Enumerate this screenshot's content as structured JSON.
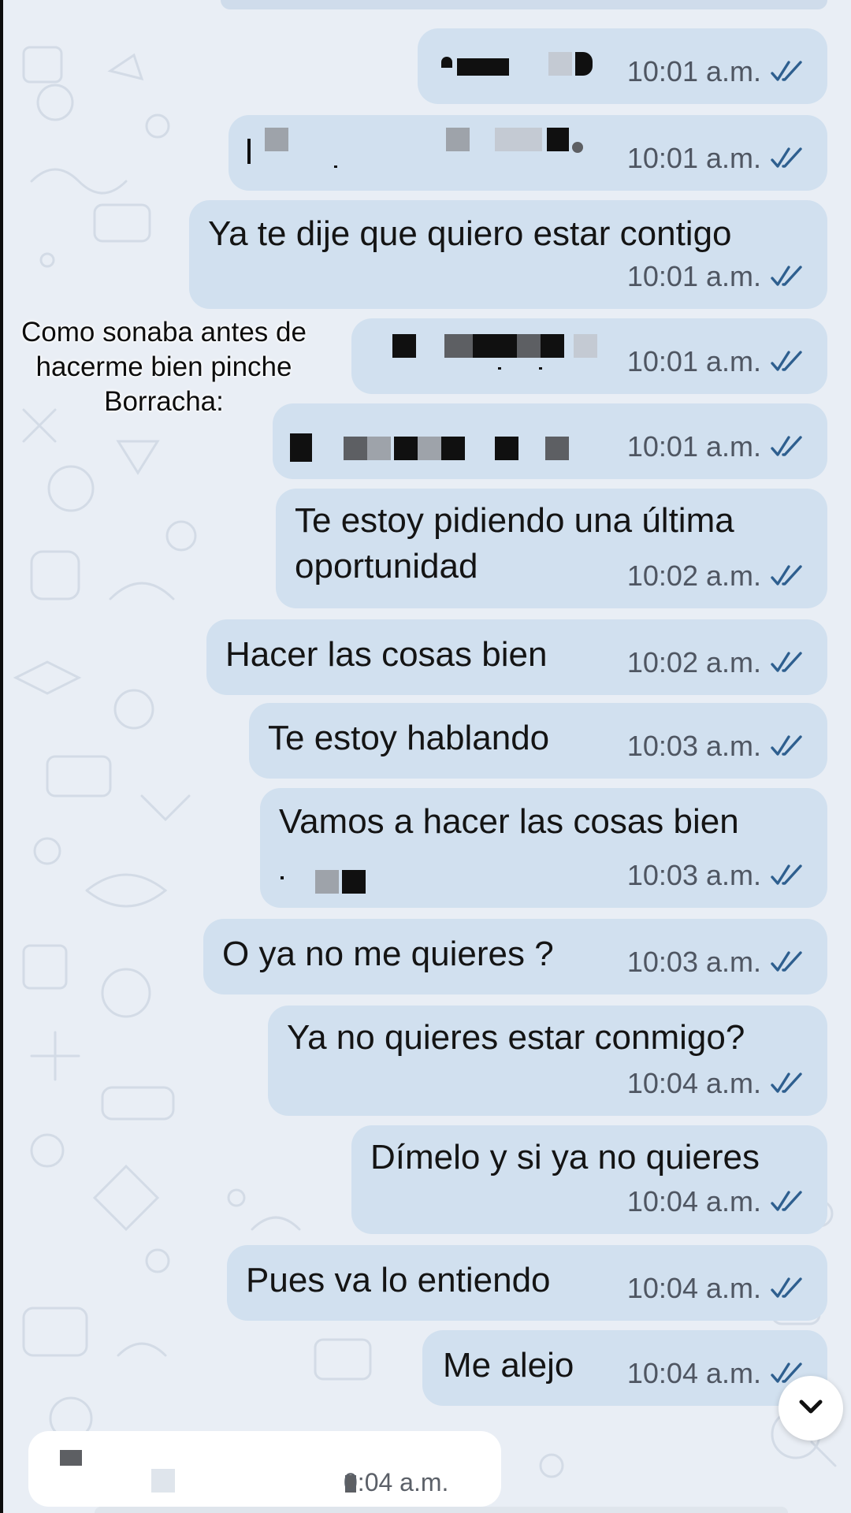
{
  "caption": {
    "line1": "Como sonaba antes de",
    "line2": "hacerme bien pinche",
    "line3": "Borracha:"
  },
  "messages": [
    {
      "text": "",
      "time": "10:01 a.m.",
      "redacted": true
    },
    {
      "text": "",
      "time": "10:01 a.m.",
      "redacted": true
    },
    {
      "text": "Ya te dije que quiero estar contigo",
      "time": "10:01 a.m."
    },
    {
      "text": "",
      "time": "10:01 a.m.",
      "redacted": true
    },
    {
      "text": "",
      "time": "10:01 a.m.",
      "redacted": true
    },
    {
      "text1": "Te estoy pidiendo una última",
      "text2": "oportunidad",
      "time": "10:02 a.m."
    },
    {
      "text": "Hacer las cosas bien",
      "time": "10:02 a.m."
    },
    {
      "text": "Te estoy hablando",
      "time": "10:03 a.m."
    },
    {
      "text": "Vamos a hacer las cosas bien",
      "time": "10:03 a.m."
    },
    {
      "text": "O ya no me quieres ?",
      "time": "10:03 a.m."
    },
    {
      "text": "Ya no quieres estar conmigo?",
      "time": "10:04 a.m."
    },
    {
      "text": "Dímelo y si ya no quieres",
      "time": "10:04 a.m."
    },
    {
      "text": "Pues va lo entiendo",
      "time": "10:04 a.m."
    },
    {
      "text": "Me alejo",
      "time": "10:04 a.m."
    }
  ],
  "incoming": {
    "time": "10:04 a.m.",
    "time_shown": "0:04 a.m.",
    "redacted": true
  },
  "icons": {
    "read_receipt": "double-check-icon",
    "scroll": "chevron-down-icon"
  },
  "colors": {
    "outgoing_bubble": "#d1e0ef",
    "incoming_bubble": "#ffffff",
    "tick": "#2e5f8f",
    "background": "#e9eef5"
  }
}
